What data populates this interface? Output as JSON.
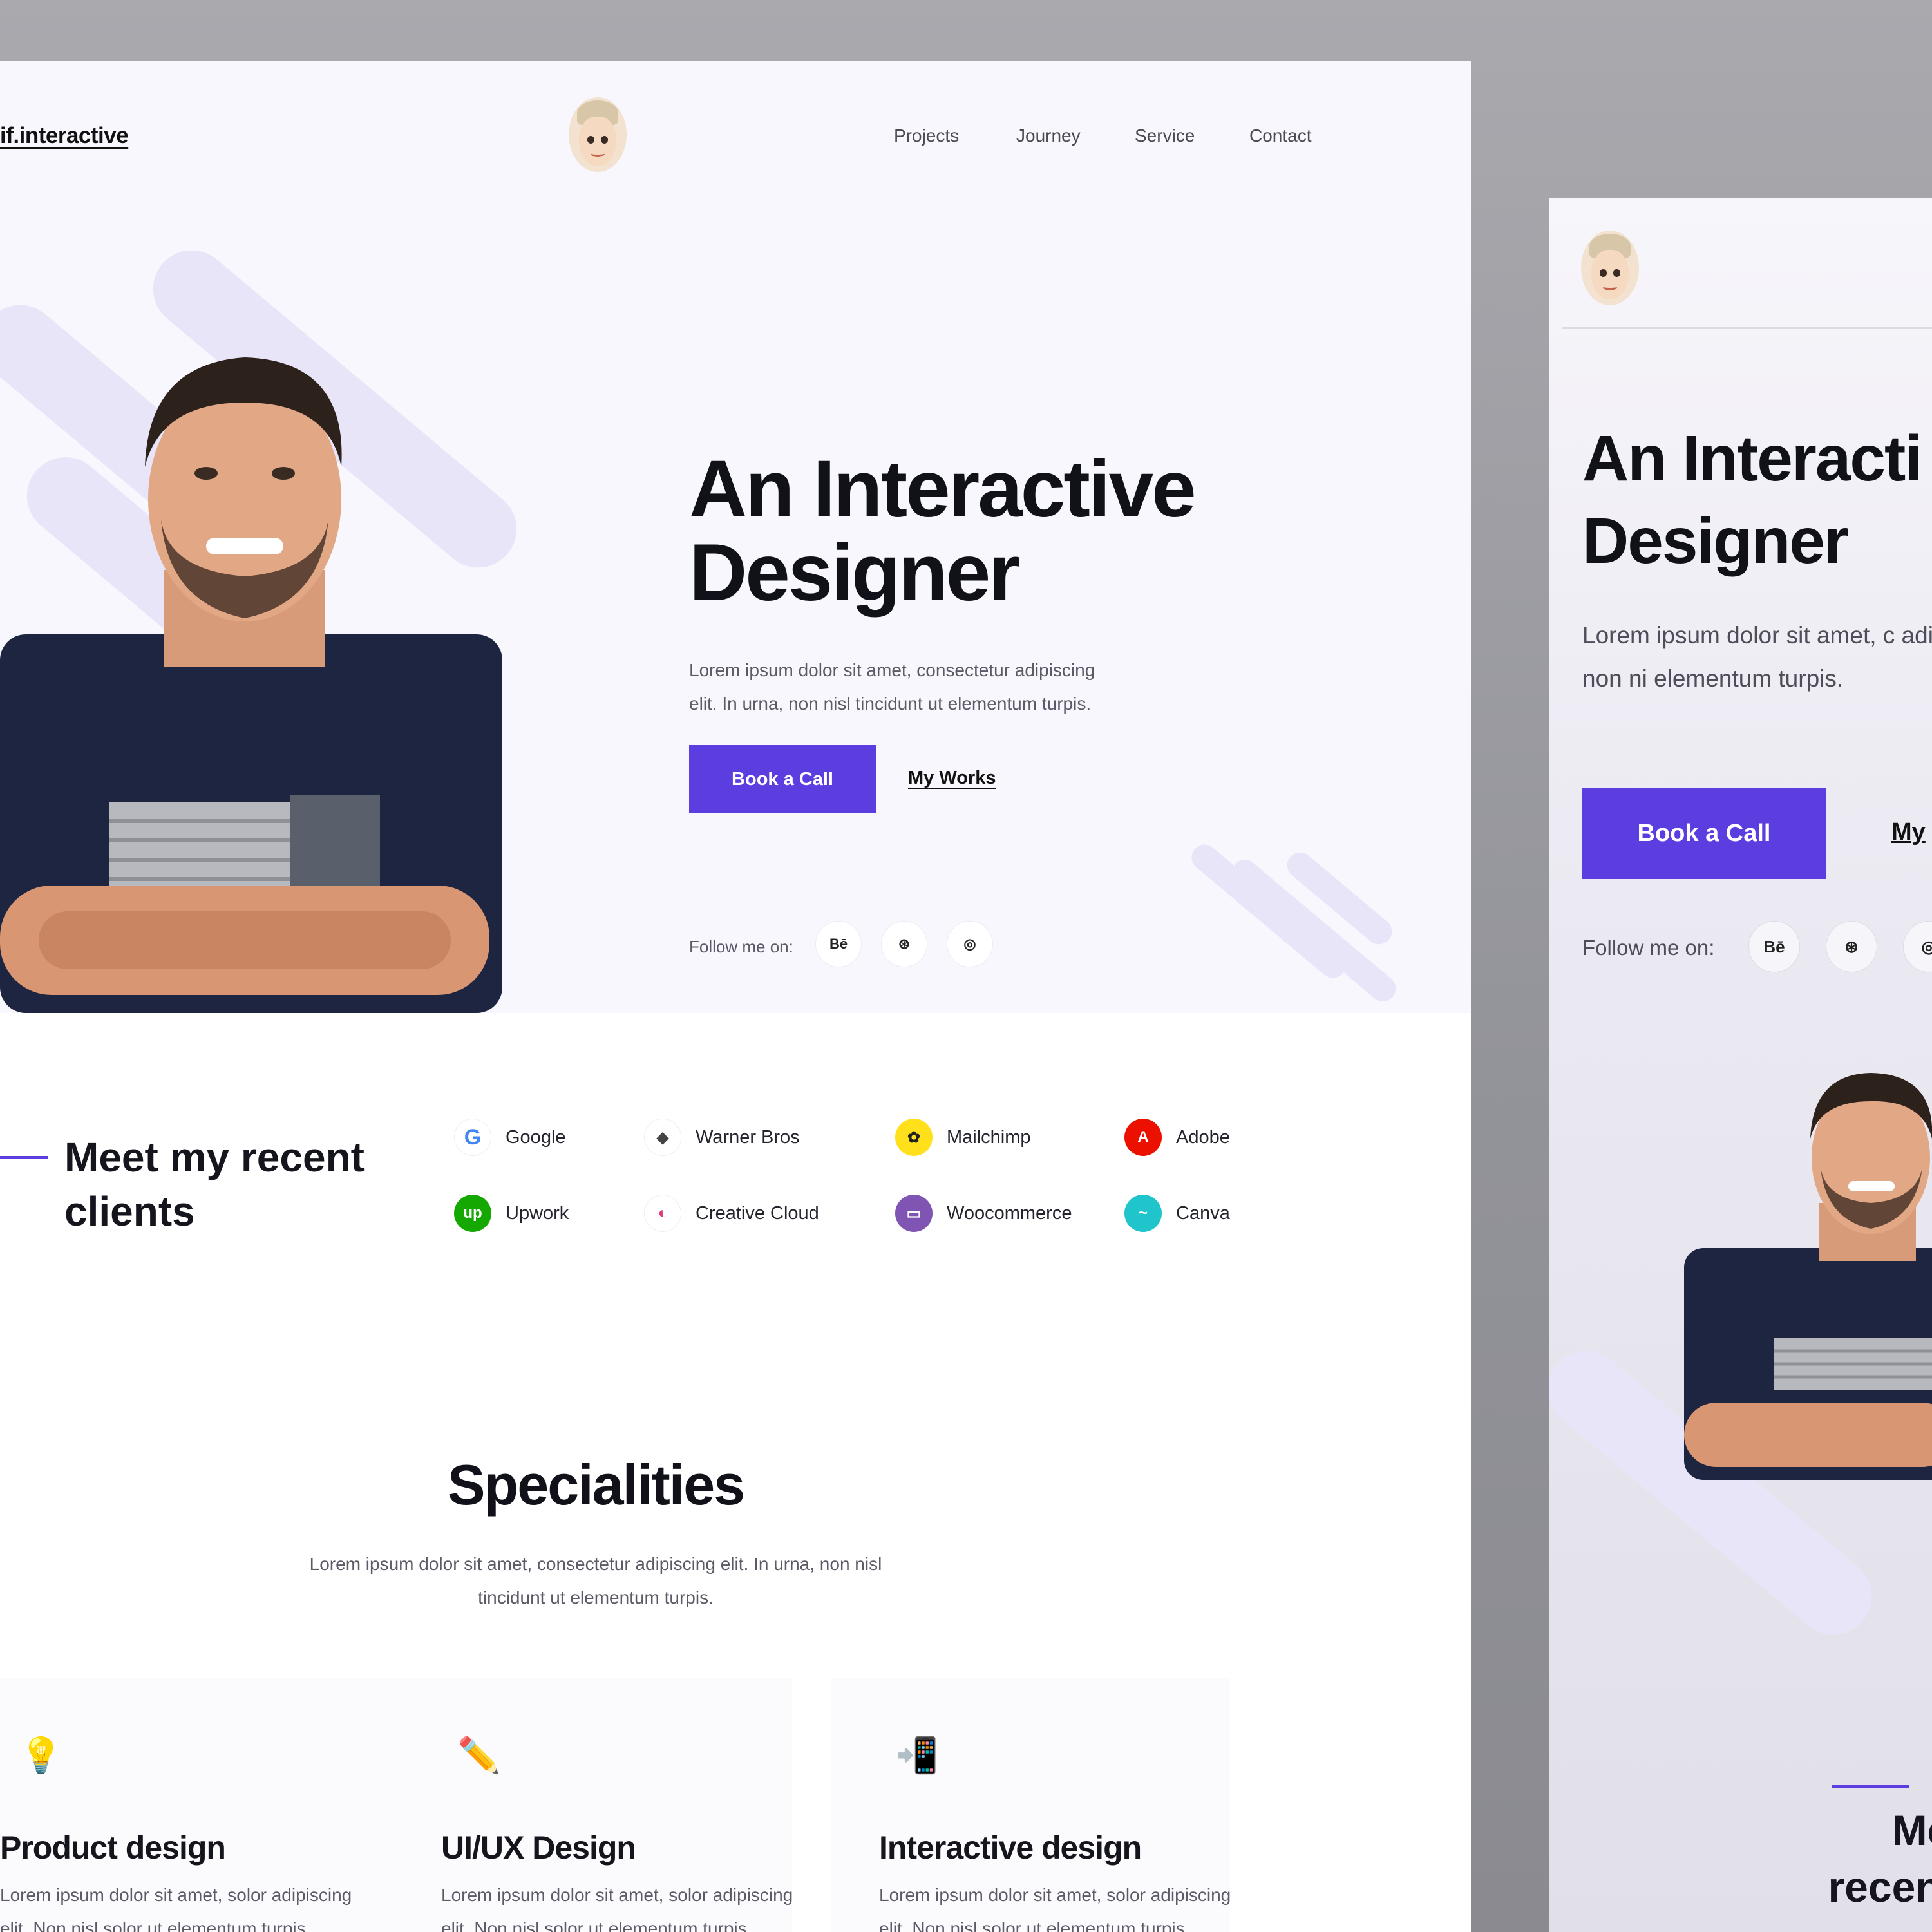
{
  "desktop": {
    "logo": "if.interactive",
    "nav": [
      "Projects",
      "Journey",
      "Service",
      "Contact"
    ],
    "hero": {
      "title_line1": "An Interactive",
      "title_line2": "Designer",
      "lead": "Lorem ipsum dolor sit amet, consectetur adipiscing elit. In urna, non nisl tincidunt ut elementum turpis.",
      "cta_primary": "Book a Call",
      "cta_secondary": "My Works",
      "follow_label": "Follow me on:",
      "social": [
        {
          "icon": "behance-icon",
          "glyph": "Bē"
        },
        {
          "icon": "dribbble-icon",
          "glyph": "⊛"
        },
        {
          "icon": "instagram-icon",
          "glyph": "◎"
        }
      ]
    },
    "clients": {
      "title": "Meet my recent clients",
      "items": [
        {
          "name": "Google",
          "icon": "google-icon",
          "color": "#ffffff",
          "glyph": "G"
        },
        {
          "name": "Warner Bros",
          "icon": "warner-bros-icon",
          "color": "#ffffff",
          "glyph": "◆"
        },
        {
          "name": "Mailchimp",
          "icon": "mailchimp-icon",
          "color": "#ffe01b",
          "glyph": "✿"
        },
        {
          "name": "Adobe",
          "icon": "adobe-icon",
          "color": "#eb1000",
          "glyph": "A"
        },
        {
          "name": "Upwork",
          "icon": "upwork-icon",
          "color": "#14a800",
          "glyph": "up"
        },
        {
          "name": "Creative Cloud",
          "icon": "creative-cloud-icon",
          "color": "#ffffff",
          "glyph": "◐"
        },
        {
          "name": "Woocommerce",
          "icon": "woocommerce-icon",
          "color": "#7f54b3",
          "glyph": "▭"
        },
        {
          "name": "Canva",
          "icon": "canva-icon",
          "color": "#20c4cb",
          "glyph": "~"
        }
      ]
    },
    "specialities": {
      "title": "Specialities",
      "lead": "Lorem ipsum dolor sit amet, consectetur adipiscing elit. In urna, non nisl tincidunt ut elementum turpis.",
      "cards": [
        {
          "title": "Product design",
          "icon": "lightbulb-icon",
          "glyph": "💡",
          "desc": "Lorem ipsum dolor sit amet, solor adipiscing elit. Non nisl solor ut elementum turpis."
        },
        {
          "title": "UI/UX Design",
          "icon": "pencil-ruler-icon",
          "glyph": "✏️",
          "desc": "Lorem ipsum dolor sit amet, solor adipiscing elit. Non nisl solor ut elementum turpis."
        },
        {
          "title": "Interactive design",
          "icon": "mobile-tap-icon",
          "glyph": "📲",
          "desc": "Lorem ipsum dolor sit amet, solor adipiscing elit. Non nisl solor ut elementum turpis."
        }
      ]
    }
  },
  "mobile": {
    "title_line1": "An Interacti",
    "title_line2": "Designer",
    "lead": "Lorem ipsum dolor sit amet, c adipiscing elit. In urna, non ni elementum turpis.",
    "cta_primary": "Book a Call",
    "cta_secondary": "My",
    "follow_label": "Follow me on:",
    "social": [
      {
        "icon": "behance-icon",
        "glyph": "Bē"
      },
      {
        "icon": "dribbble-icon",
        "glyph": "⊛"
      },
      {
        "icon": "instagram-icon",
        "glyph": "◎"
      }
    ],
    "clients_line1": "Meet m",
    "clients_line2": "recent clie"
  },
  "colors": {
    "accent": "#5b3de0",
    "hero_bg": "#f8f7fd",
    "stroke": "#e8e5f8"
  }
}
